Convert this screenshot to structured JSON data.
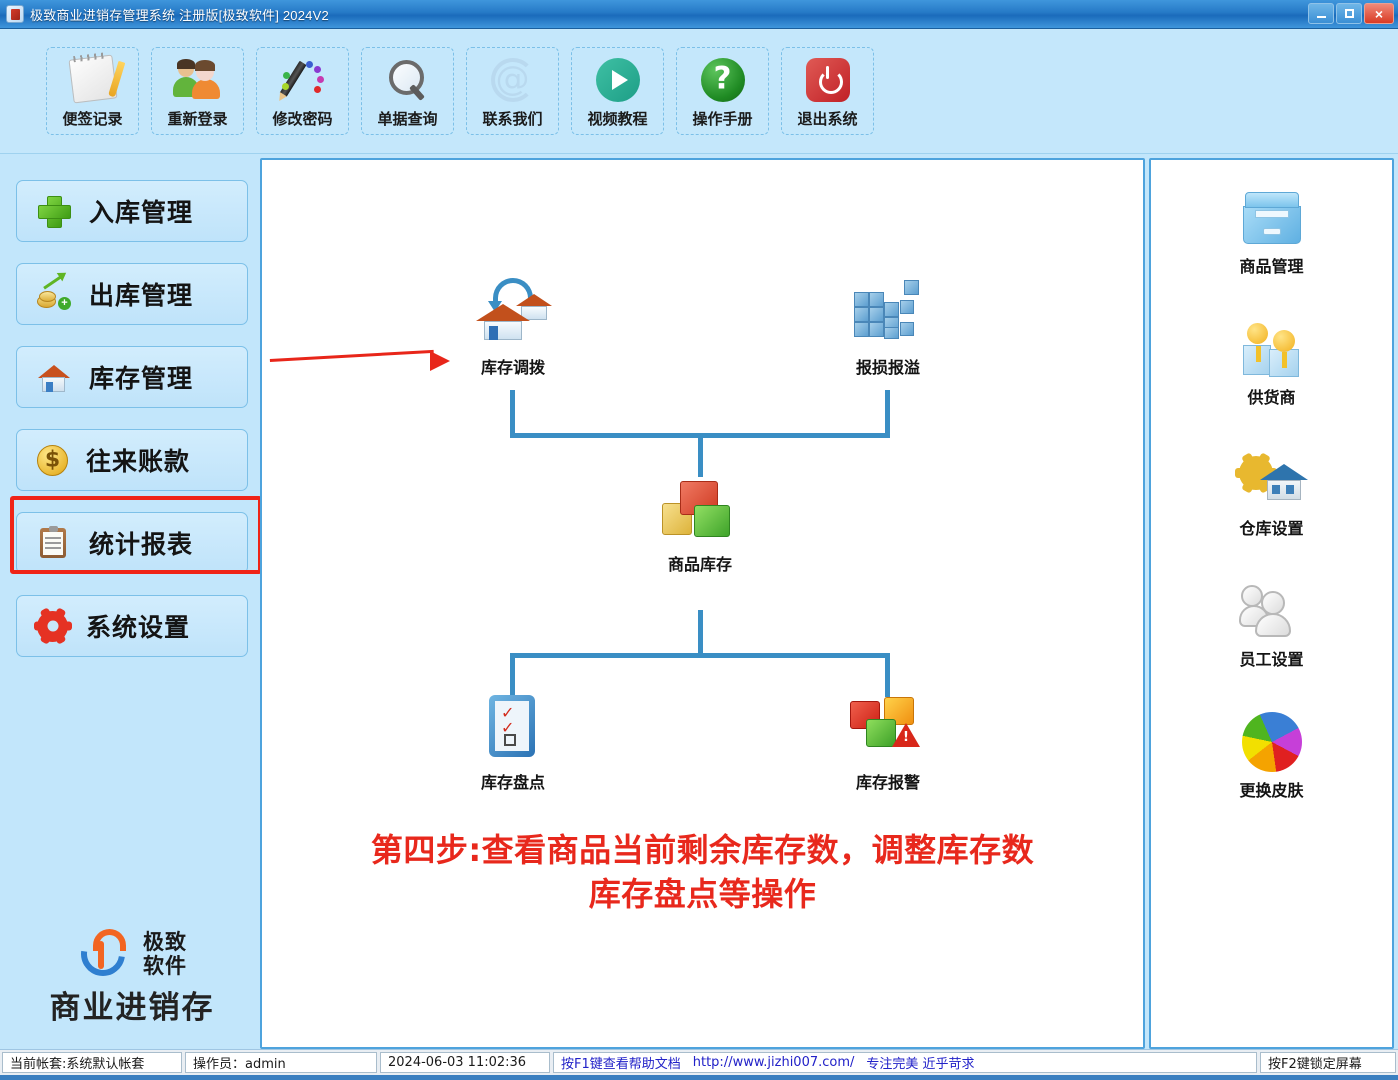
{
  "window": {
    "title": "极致商业进销存管理系统 注册版[极致软件] 2024V2",
    "minimize_label": "最小化",
    "maximize_label": "最大化",
    "close_label": "×"
  },
  "toolbar": {
    "items": [
      {
        "label": "便签记录",
        "icon": "note-icon"
      },
      {
        "label": "重新登录",
        "icon": "users-icon"
      },
      {
        "label": "修改密码",
        "icon": "pencil-palette-icon"
      },
      {
        "label": "单据查询",
        "icon": "magnifier-icon"
      },
      {
        "label": "联系我们",
        "icon": "at-sign-icon"
      },
      {
        "label": "视频教程",
        "icon": "play-circle-icon"
      },
      {
        "label": "操作手册",
        "icon": "question-circle-icon"
      },
      {
        "label": "退出系统",
        "icon": "power-icon"
      }
    ]
  },
  "sidebar": {
    "items": [
      {
        "label": "入库管理",
        "icon": "green-plus-icon",
        "selected": false
      },
      {
        "label": "出库管理",
        "icon": "money-chart-icon",
        "selected": false
      },
      {
        "label": "库存管理",
        "icon": "house-icon",
        "selected": true
      },
      {
        "label": "往来账款",
        "icon": "dollar-coin-icon",
        "selected": false
      },
      {
        "label": "统计报表",
        "icon": "clipboard-icon",
        "selected": false
      },
      {
        "label": "系统设置",
        "icon": "red-gear-icon",
        "selected": false
      }
    ],
    "logo": {
      "line1": "极致",
      "line2": "软件",
      "subtitle": "商业进销存"
    }
  },
  "main": {
    "nodes": [
      {
        "id": "transfer",
        "label": "库存调拨",
        "icon": "house-transfer-icon"
      },
      {
        "id": "loss",
        "label": "报损报溢",
        "icon": "blue-cubes-icon"
      },
      {
        "id": "stock",
        "label": "商品库存",
        "icon": "colored-boxes-icon"
      },
      {
        "id": "count",
        "label": "库存盘点",
        "icon": "checklist-tablet-icon"
      },
      {
        "id": "alert",
        "label": "库存报警",
        "icon": "cubes-warning-icon"
      }
    ],
    "annotation": {
      "line1": "第四步:查看商品当前剩余库存数，调整库存数",
      "line2": "库存盘点等操作",
      "color": "#e8281c"
    },
    "arrow": {
      "color": "#e8261a",
      "points_to": "库存调拨"
    }
  },
  "rightbar": {
    "items": [
      {
        "label": "商品管理",
        "icon": "file-box-icon"
      },
      {
        "label": "供货商",
        "icon": "two-persons-icon"
      },
      {
        "label": "仓库设置",
        "icon": "gear-house-icon"
      },
      {
        "label": "员工设置",
        "icon": "group-people-icon"
      },
      {
        "label": "更换皮肤",
        "icon": "color-wheel-icon"
      }
    ]
  },
  "statusbar": {
    "account_set": "当前帐套:系统默认帐套",
    "operator": "操作员：admin",
    "datetime": "2024-06-03 11:02:36",
    "help_hint": "按F1键查看帮助文档",
    "url": "http://www.jizhi007.com/",
    "slogan": "专注完美 近乎苛求",
    "lock_hint": "按F2键锁定屏幕"
  }
}
